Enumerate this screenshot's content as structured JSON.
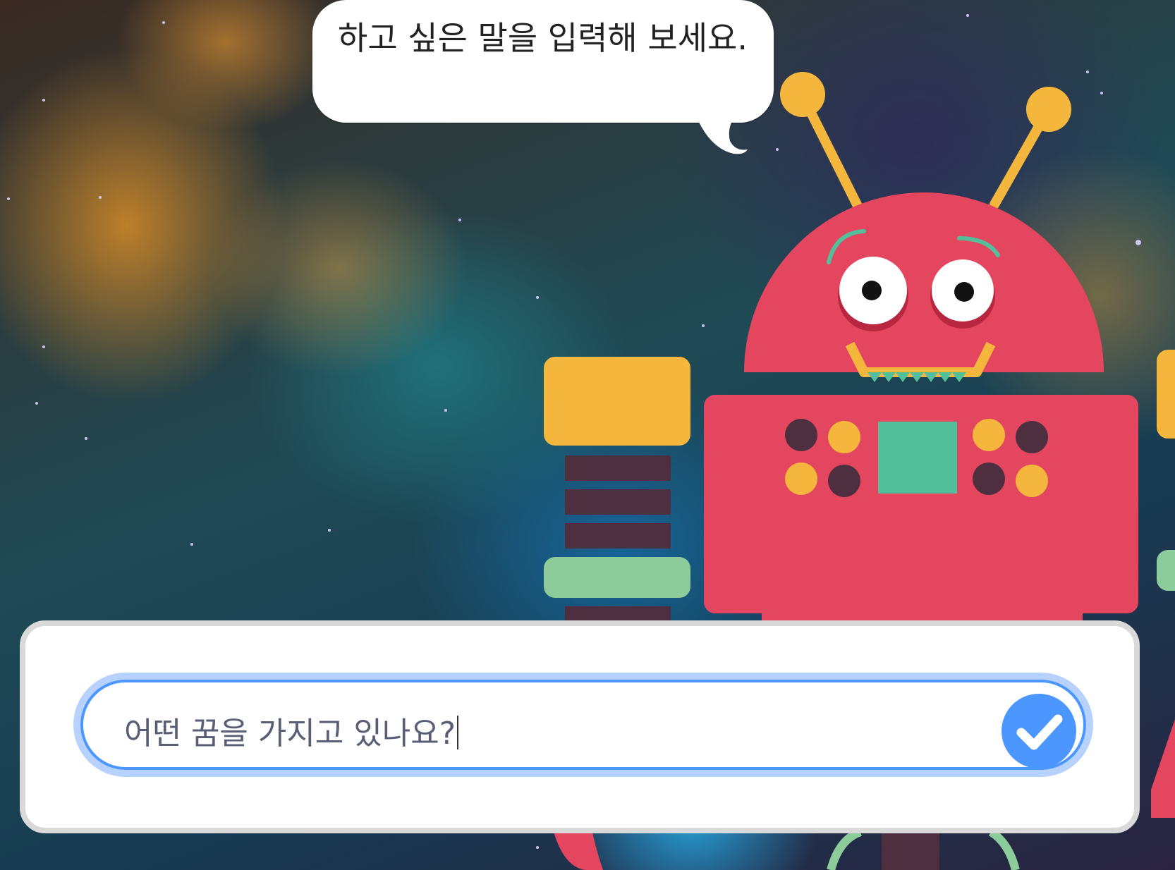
{
  "speech_bubble": {
    "text": "하고 싶은 말을 입력해 보세요."
  },
  "ask_prompt": {
    "value": "어떤 꿈을 가지고 있나요?",
    "submit_icon": "checkmark-icon"
  },
  "colors": {
    "robot_body": "#e5465f",
    "robot_accent": "#f4b63d",
    "robot_panel": "#54bf9b",
    "robot_dark": "#4e2f3f",
    "robot_green": "#8ccb9a",
    "input_border": "#4c97ff",
    "input_glow": "#b8d2ff"
  }
}
